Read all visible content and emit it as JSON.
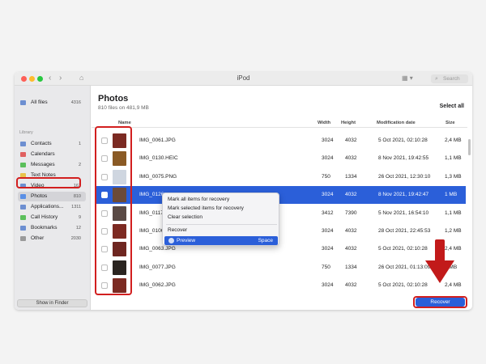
{
  "window": {
    "title": "iPod"
  },
  "search": {
    "placeholder": "Search"
  },
  "sidebar": {
    "all_files": {
      "label": "All files",
      "count": "4316"
    },
    "section_label": "Library",
    "items": [
      {
        "label": "Contacts",
        "count": "1",
        "color": "#6d8fd1"
      },
      {
        "label": "Calendars",
        "count": "",
        "color": "#e06060"
      },
      {
        "label": "Messages",
        "count": "2",
        "color": "#5bbf5b"
      },
      {
        "label": "Text Notes",
        "count": "",
        "color": "#e8c24a"
      },
      {
        "label": "Video",
        "count": "161",
        "color": "#6d8fd1"
      },
      {
        "label": "Photos",
        "count": "810",
        "color": "#5a8fe6"
      },
      {
        "label": "Applications...",
        "count": "1311",
        "color": "#6d8fd1"
      },
      {
        "label": "Call History",
        "count": "9",
        "color": "#5bbf5b"
      },
      {
        "label": "Bookmarks",
        "count": "12",
        "color": "#6d8fd1"
      },
      {
        "label": "Other",
        "count": "2030",
        "color": "#9a9a9a"
      }
    ],
    "show_in_finder": "Show in Finder"
  },
  "main": {
    "title": "Photos",
    "subtitle": "810 files on 481,9 MB",
    "select_all": "Select all",
    "columns": [
      "Name",
      "Width",
      "Height",
      "Modification date",
      "Size"
    ],
    "rows": [
      {
        "name": "IMG_0061.JPG",
        "width": "3024",
        "height": "4032",
        "date": "5 Oct 2021, 02:10:28",
        "size": "2,4 MB",
        "thumb": "#7b2a22"
      },
      {
        "name": "IMG_0130.HEIC",
        "width": "3024",
        "height": "4032",
        "date": "8 Nov 2021, 19:42:55",
        "size": "1,1 MB",
        "thumb": "#8a5a25"
      },
      {
        "name": "IMG_0075.PNG",
        "width": "750",
        "height": "1334",
        "date": "26 Oct 2021, 12:30:10",
        "size": "1,3 MB",
        "thumb": "#cfd6e0"
      },
      {
        "name": "IMG_0126.",
        "width": "3024",
        "height": "4032",
        "date": "8 Nov 2021, 19:42:47",
        "size": "1 MB",
        "thumb": "#6b4a38",
        "selected": true
      },
      {
        "name": "IMG_0117.",
        "width": "3412",
        "height": "7390",
        "date": "5 Nov 2021, 16:54:10",
        "size": "1,1 MB",
        "thumb": "#5a4a45"
      },
      {
        "name": "IMG_0106.",
        "width": "3024",
        "height": "4032",
        "date": "28 Oct 2021, 22:45:53",
        "size": "1,2 MB",
        "thumb": "#7d2a22"
      },
      {
        "name": "IMG_0063.JPG",
        "width": "3024",
        "height": "4032",
        "date": "5 Oct 2021, 02:10:28",
        "size": "2,4 MB",
        "thumb": "#6e2620"
      },
      {
        "name": "IMG_0077.JPG",
        "width": "750",
        "height": "1334",
        "date": "26 Oct 2021, 01:13:09",
        "size": "2 MB",
        "thumb": "#2a2420"
      },
      {
        "name": "IMG_0062.JPG",
        "width": "3024",
        "height": "4032",
        "date": "5 Oct 2021, 02:10:28",
        "size": "2,4 MB",
        "thumb": "#7b2a22"
      }
    ]
  },
  "context_menu": {
    "mark_all": "Mark all items for recovery",
    "mark_selected": "Mark selected items for recovery",
    "clear": "Clear selection",
    "recover": "Recover",
    "preview": "Preview",
    "preview_shortcut": "Space"
  },
  "recover_button": "Recover",
  "colors": {
    "accent": "#2b5fd9",
    "annotation": "#d21f1f"
  }
}
